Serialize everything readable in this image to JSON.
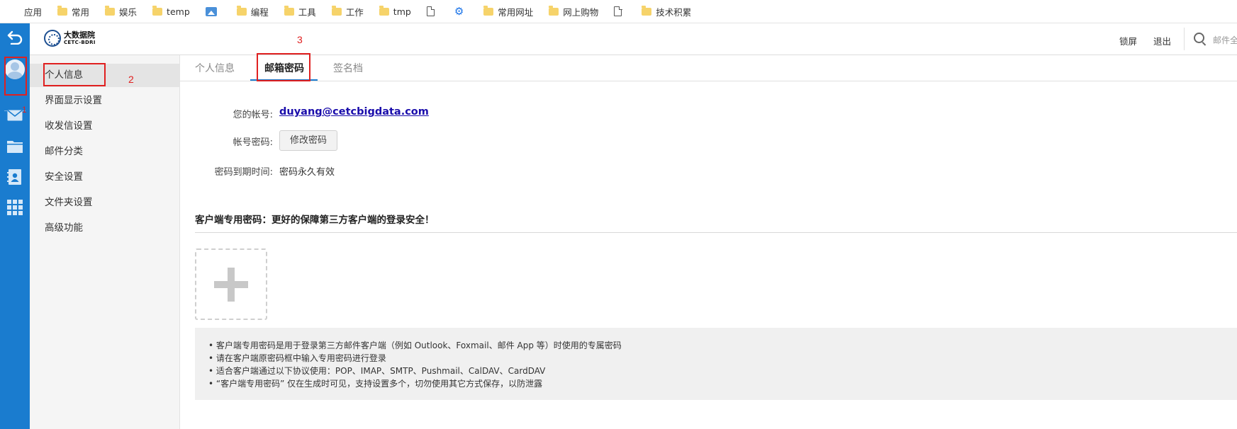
{
  "bookmarks": [
    {
      "label": "应用",
      "icon": "apps-grid-icon"
    },
    {
      "label": "常用",
      "icon": "folder-icon"
    },
    {
      "label": "娱乐",
      "icon": "folder-icon"
    },
    {
      "label": "temp",
      "icon": "folder-icon"
    },
    {
      "label": "",
      "icon": "image-icon"
    },
    {
      "label": "编程",
      "icon": "folder-icon"
    },
    {
      "label": "工具",
      "icon": "folder-icon"
    },
    {
      "label": "工作",
      "icon": "folder-icon"
    },
    {
      "label": "tmp",
      "icon": "folder-icon"
    },
    {
      "label": "",
      "icon": "page-icon"
    },
    {
      "label": "",
      "icon": "gear-icon"
    },
    {
      "label": "常用网址",
      "icon": "folder-icon"
    },
    {
      "label": "网上购物",
      "icon": "folder-icon"
    },
    {
      "label": "",
      "icon": "page-icon"
    },
    {
      "label": "技术积累",
      "icon": "folder-icon"
    }
  ],
  "header": {
    "logo_cn": "大数据院",
    "logo_en": "CETC-BDRI",
    "lock_label": "锁屏",
    "logout_label": "退出",
    "search_placeholder": "邮件全"
  },
  "rail": {
    "items": [
      "back-icon",
      "avatar",
      "mail-icon",
      "folder-icon",
      "contacts-icon",
      "apps-icon"
    ]
  },
  "sidebar": {
    "items": [
      {
        "label": "个人信息",
        "active": true
      },
      {
        "label": "界面显示设置"
      },
      {
        "label": "收发信设置"
      },
      {
        "label": "邮件分类"
      },
      {
        "label": "安全设置"
      },
      {
        "label": "文件夹设置"
      },
      {
        "label": "高级功能"
      }
    ]
  },
  "tabs": [
    {
      "label": "个人信息"
    },
    {
      "label": "邮箱密码",
      "active": true
    },
    {
      "label": "签名档"
    }
  ],
  "account": {
    "account_label": "您的帐号:",
    "account_value": "duyang@cetcbigdata.com",
    "password_label": "帐号密码:",
    "change_password_button": "修改密码",
    "expiry_label": "密码到期时间:",
    "expiry_value": "密码永久有效"
  },
  "client_password": {
    "title": "客户端专用密码：更好的保障第三方客户端的登录安全！",
    "notes": [
      "• 客户端专用密码是用于登录第三方邮件客户端（例如 Outlook、Foxmail、邮件 App 等）时使用的专属密码",
      "• 请在客户端原密码框中输入专用密码进行登录",
      "• 适合客户端通过以下协议使用：POP、IMAP、SMTP、Pushmail、CalDAV、CardDAV",
      "• “客户端专用密码” 仅在生成时可见，支持设置多个，切勿使用其它方式保存，以防泄露"
    ]
  },
  "annotations": [
    "1",
    "2",
    "3"
  ],
  "colors": {
    "rail": "#1a7ccf",
    "annotation": "#e02020",
    "link": "#1a0dab"
  }
}
